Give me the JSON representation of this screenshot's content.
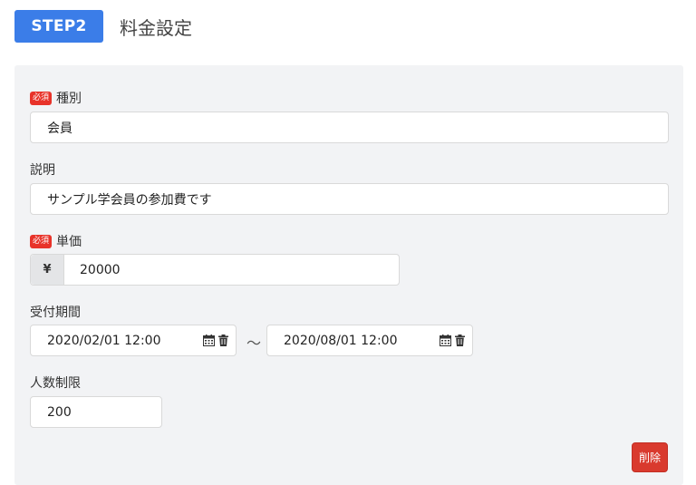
{
  "header": {
    "step_label": "STEP2",
    "title": "料金設定"
  },
  "form": {
    "required_badge": "必須",
    "type": {
      "label": "種別",
      "value": "会員"
    },
    "description": {
      "label": "説明",
      "value": "サンプル学会員の参加費です"
    },
    "price": {
      "label": "単価",
      "currency": "¥",
      "value": "20000"
    },
    "period": {
      "label": "受付期間",
      "start": "2020/02/01 12:00",
      "separator": "〜",
      "end": "2020/08/01 12:00"
    },
    "limit": {
      "label": "人数制限",
      "value": "200"
    }
  },
  "actions": {
    "delete_label": "削除"
  },
  "colors": {
    "accent": "#3b7de8",
    "required": "#e8332a",
    "danger": "#d93a2e"
  }
}
